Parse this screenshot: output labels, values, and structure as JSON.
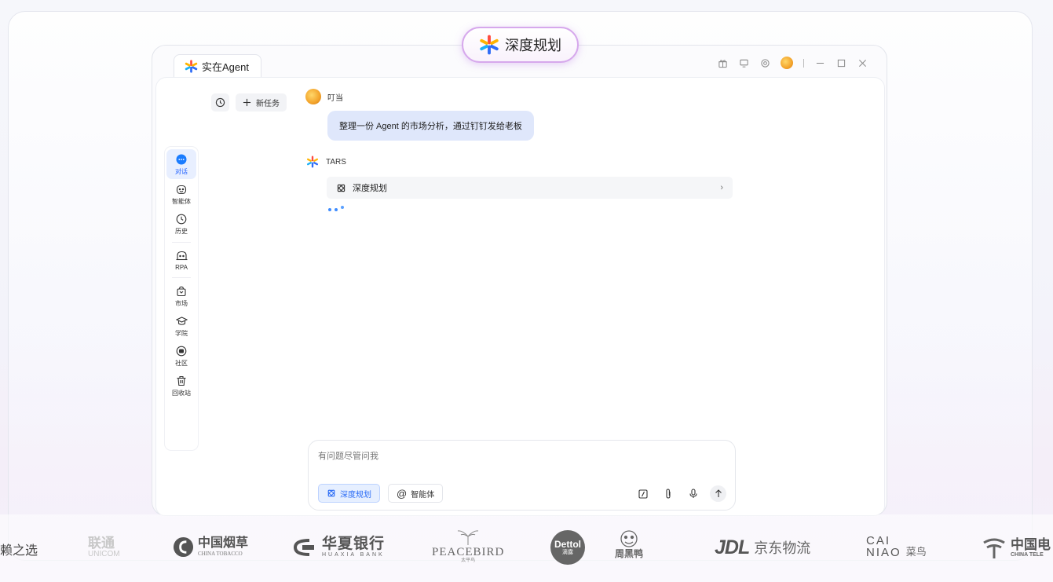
{
  "badge": {
    "label": "深度规划",
    "accent": "#d6a8ec"
  },
  "tab": {
    "title": "实在Agent"
  },
  "actions": {
    "new_task": "新任务"
  },
  "sidebar": {
    "items": [
      {
        "label": "对话",
        "icon": "chat-bubble-icon",
        "active": true
      },
      {
        "label": "智能体",
        "icon": "agent-face-icon"
      },
      {
        "label": "历史",
        "icon": "clock-icon"
      },
      {
        "label": "RPA",
        "icon": "robot-icon"
      },
      {
        "label": "市场",
        "icon": "shopping-bag-icon"
      },
      {
        "label": "学院",
        "icon": "graduation-cap-icon"
      },
      {
        "label": "社区",
        "icon": "community-icon"
      },
      {
        "label": "回收站",
        "icon": "trash-icon"
      }
    ]
  },
  "chat": {
    "user_name": "叮当",
    "user_message": "整理一份 Agent 的市场分析，通过钉钉发给老板",
    "bot_name": "TARS",
    "plan_card": "深度规划"
  },
  "input": {
    "placeholder": "有问题尽管问我",
    "chip_plan": "深度规划",
    "chip_agent": "智能体"
  },
  "logos": {
    "slogan": "赖之选",
    "unicom_cn": "联通",
    "unicom_en": "UNICOM",
    "tobacco_cn": "中国烟草",
    "tobacco_en": "CHINA TOBACCO",
    "huaxia_cn": "华夏银行",
    "huaxia_en": "HUAXIA BANK",
    "peacebird_en": "PEACEBIRD",
    "peacebird_cn": "太平鸟",
    "dettol": "Dettol",
    "dettol_cn": "滴露",
    "zhouheiya": "周黑鸭",
    "jdl_mark": "JDL",
    "jdl_cn": "京东物流",
    "cainiao_en_1": "CAI",
    "cainiao_en_2": "NIAO",
    "cainiao_cn": "菜鸟",
    "telecom_cn": "中国电",
    "telecom_en": "CHINA TELE"
  },
  "colors": {
    "primary": "#2b6cf5",
    "active_bg": "#e8efff",
    "bubble_bg": "#dfe7fb"
  }
}
